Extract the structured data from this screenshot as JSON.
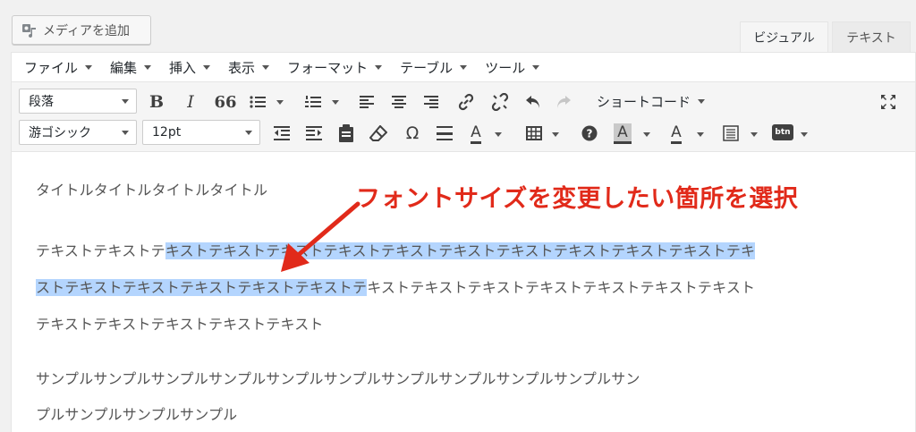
{
  "top": {
    "media_button": "メディアを追加",
    "tab_visual": "ビジュアル",
    "tab_text": "テキスト"
  },
  "menubar": {
    "items": [
      "ファイル",
      "編集",
      "挿入",
      "表示",
      "フォーマット",
      "テーブル",
      "ツール"
    ]
  },
  "toolbar": {
    "format_select": "段落",
    "font_select": "游ゴシック",
    "size_select": "12pt",
    "shortcode_label": "ショートコード",
    "btn_label": "btn",
    "bold": "B",
    "italic": "I",
    "quote": "66",
    "omega": "Ω",
    "color_a": "A"
  },
  "content": {
    "title": "タイトルタイトルタイトルタイトル",
    "line1_pre": "テキストテキストテ",
    "line1_sel": "キストテキストテキストテキストテキストテキストテキストテキストテキストテキストテキ",
    "line2_sel": "ストテキストテキストテキストテキストテキストテ",
    "line2_post": "キストテキストテキストテキストテキストテキストテキスト",
    "line3": "テキストテキストテキストテキストテキスト",
    "line4": "サンプルサンプルサンプルサンプルサンプルサンプルサンプルサンプルサンプルサンプルサン",
    "line5": "プルサンプルサンプルサンプル"
  },
  "annotation": {
    "text": "フォントサイズを変更したい箇所を選択",
    "color": "#e12a1a"
  },
  "colors": {
    "selection": "#b4d5fe",
    "toolbar_bg": "#f5f5f5"
  }
}
